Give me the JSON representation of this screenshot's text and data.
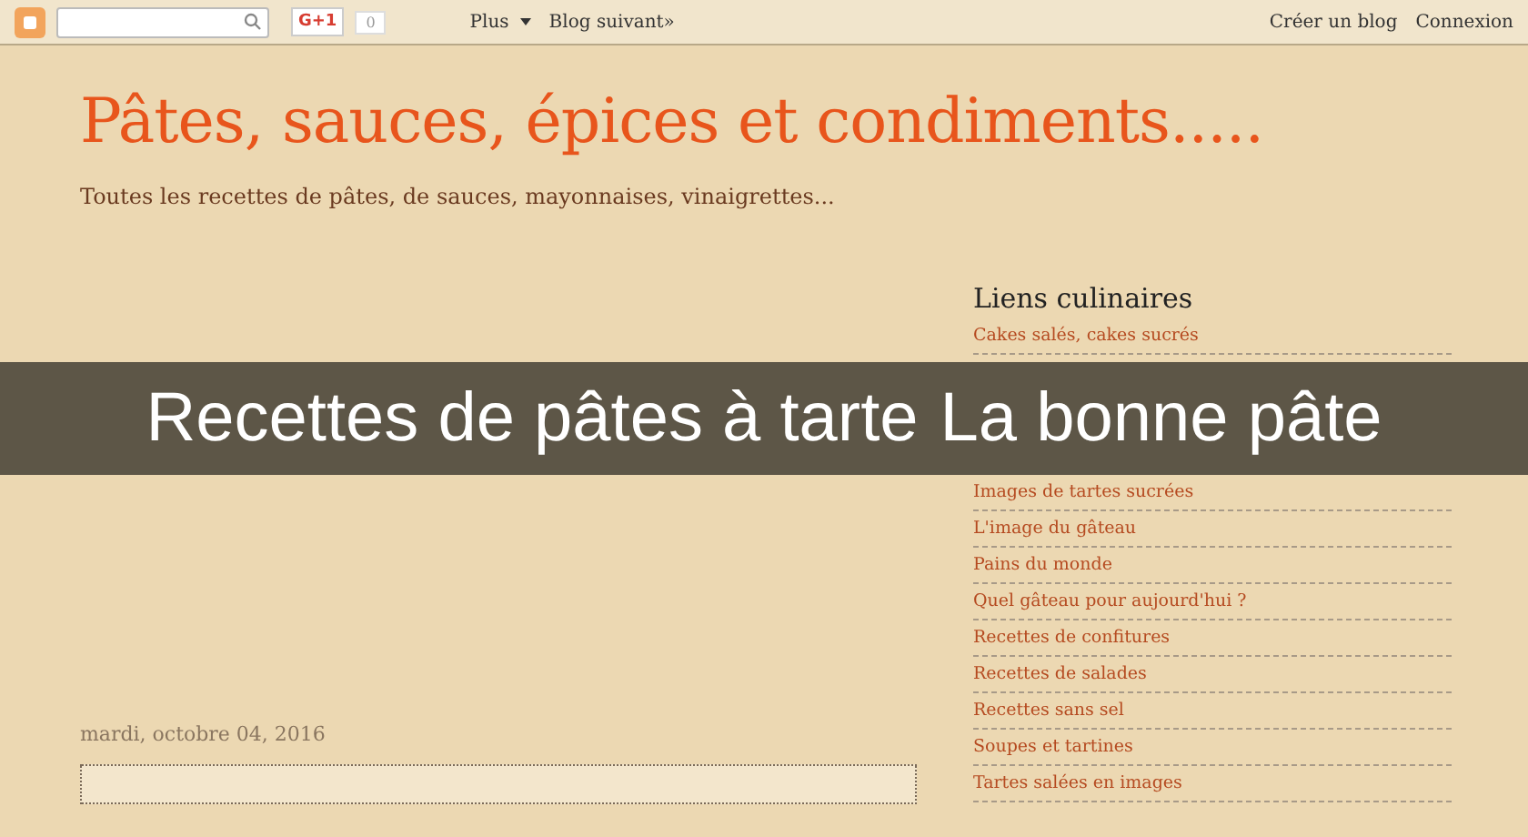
{
  "navbar": {
    "plusone": "G+1",
    "count": "0",
    "more": "Plus",
    "next_blog": "Blog suivant»",
    "create_blog": "Créer un blog",
    "login": "Connexion"
  },
  "header": {
    "title": "Pâtes, sauces, épices et condiments.....",
    "description": "Toutes les recettes de pâtes, de sauces, mayonnaises, vinaigrettes..."
  },
  "sidebar": {
    "heading": "Liens culinaires",
    "links": [
      {
        "label": "Cakes salés, cakes sucrés"
      },
      {
        "label": "Images de tartes sucrées"
      },
      {
        "label": "L'image du gâteau"
      },
      {
        "label": "Pains du monde"
      },
      {
        "label": "Quel gâteau pour aujourd'hui ?"
      },
      {
        "label": "Recettes de confitures"
      },
      {
        "label": "Recettes de salades"
      },
      {
        "label": "Recettes sans sel"
      },
      {
        "label": "Soupes et tartines"
      },
      {
        "label": "Tartes salées en images"
      }
    ]
  },
  "post": {
    "date": "mardi, octobre 04, 2016"
  },
  "banner": {
    "left": "Recettes de pâtes à tarte",
    "right": "La bonne pâte"
  }
}
